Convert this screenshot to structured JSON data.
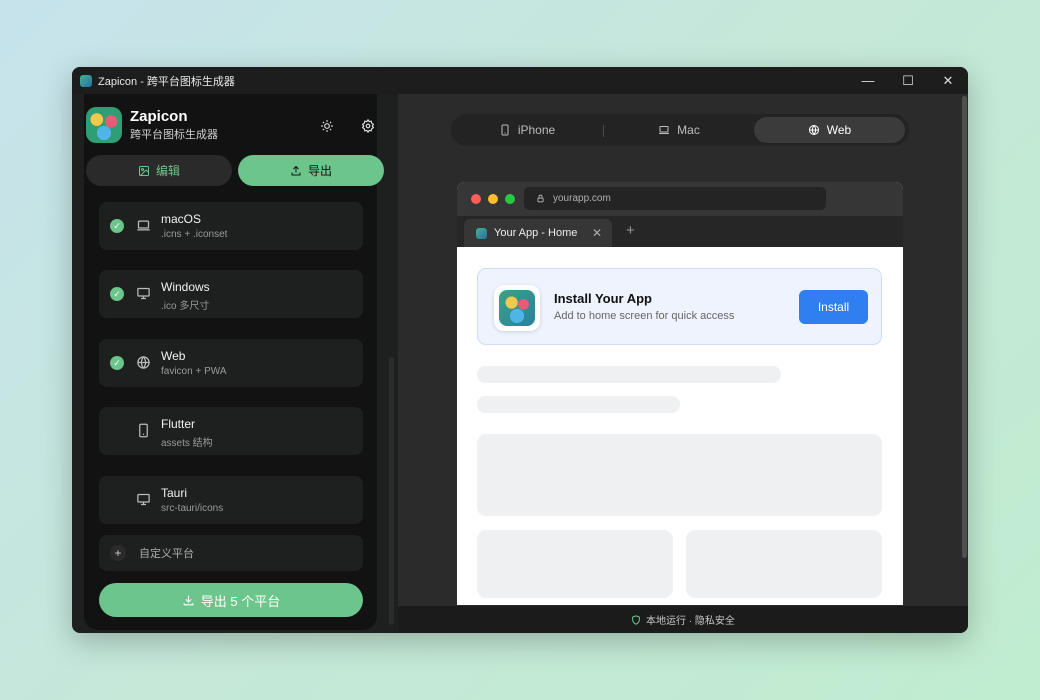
{
  "window": {
    "title": "Zapicon - 跨平台图标生成器"
  },
  "window_controls": {
    "minimize": "—",
    "maximize": "☐",
    "close": "✕"
  },
  "brand": {
    "name": "Zapicon",
    "subtitle": "跨平台图标生成器"
  },
  "mode_tabs": {
    "edit": "编辑",
    "export": "导出"
  },
  "platforms": [
    {
      "name": "macOS",
      "desc": ".icns + .iconset",
      "checked": true,
      "icon": "laptop-icon"
    },
    {
      "name": "Windows",
      "desc": ".ico 多尺寸",
      "checked": true,
      "icon": "monitor-icon"
    },
    {
      "name": "Web",
      "desc": "favicon + PWA",
      "checked": true,
      "icon": "globe-icon"
    },
    {
      "name": "Flutter",
      "desc": "assets 结构",
      "checked": false,
      "icon": "phone-icon"
    },
    {
      "name": "Tauri",
      "desc": "src-tauri/icons",
      "checked": false,
      "icon": "monitor-icon"
    }
  ],
  "custom_platform": {
    "label": "自定义平台"
  },
  "export_all": {
    "label": "导出 5 个平台"
  },
  "preview_tabs": [
    {
      "label": "iPhone",
      "icon": "phone-icon",
      "active": false
    },
    {
      "label": "Mac",
      "icon": "laptop-icon",
      "active": false
    },
    {
      "label": "Web",
      "icon": "globe-icon",
      "active": true
    }
  ],
  "browser": {
    "url": "yourapp.com",
    "tab_title": "Your App - Home",
    "install_title": "Install Your App",
    "install_subtitle": "Add to home screen for quick access",
    "install_button": "Install"
  },
  "status": {
    "text": "本地运行 · 隐私安全"
  },
  "colors": {
    "accent": "#6cc58a",
    "install_blue": "#2f7ff0"
  }
}
